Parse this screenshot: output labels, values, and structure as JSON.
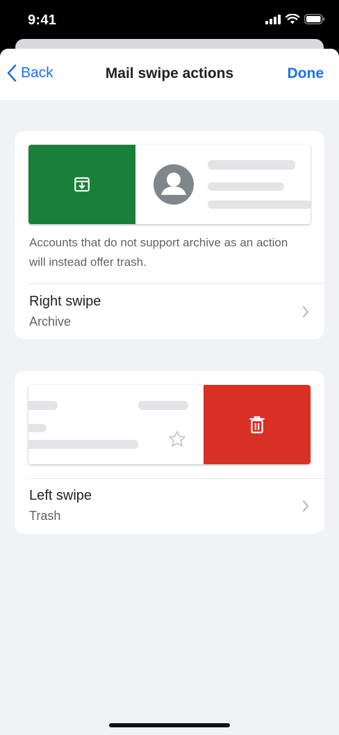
{
  "status_bar": {
    "time": "9:41",
    "icons": [
      "cellular-signal-icon",
      "wifi-icon",
      "battery-icon"
    ]
  },
  "nav": {
    "back_label": "Back",
    "title": "Mail swipe actions",
    "done_label": "Done"
  },
  "right_swipe_card": {
    "preview_action_color": "#188038",
    "preview_action_icon": "archive-icon",
    "note": "Accounts that do not support archive as an action will instead offer trash.",
    "setting_label": "Right swipe",
    "setting_value": "Archive"
  },
  "left_swipe_card": {
    "preview_action_color": "#d93025",
    "preview_action_icon": "trash-icon",
    "setting_label": "Left swipe",
    "setting_value": "Trash"
  },
  "colors": {
    "accent": "#1a73e8",
    "background": "#f1f2f4",
    "card": "#ffffff",
    "text_primary": "#202124",
    "text_secondary": "#5f6368"
  }
}
